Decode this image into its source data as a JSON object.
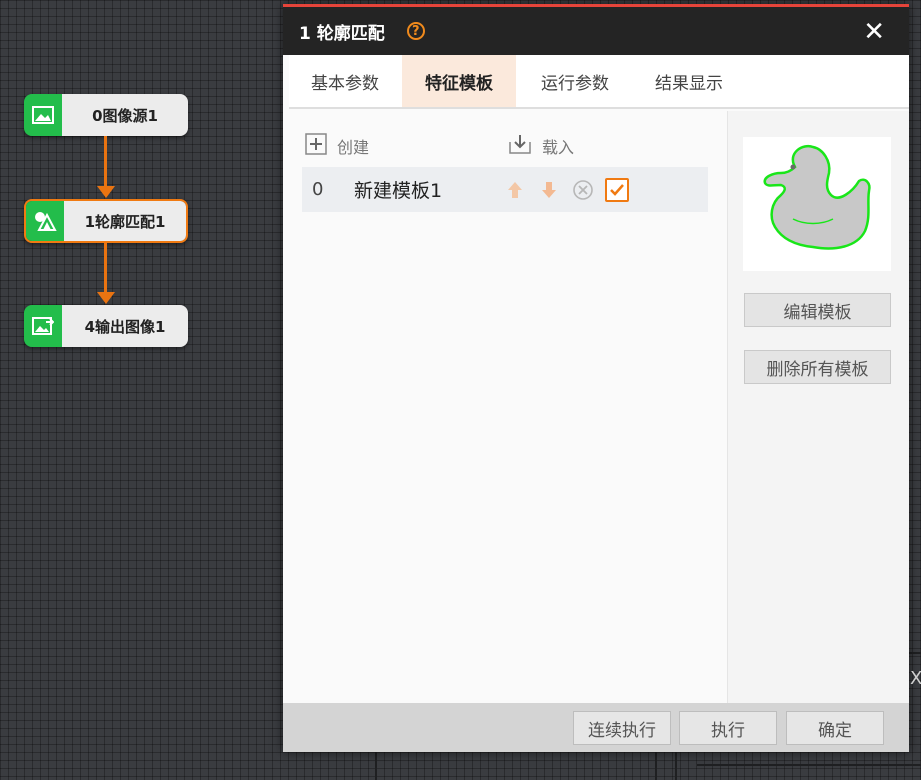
{
  "flow": {
    "nodes": [
      {
        "label": "0图像源1",
        "icon": "image-icon"
      },
      {
        "label": "1轮廓匹配1",
        "icon": "shape-match-icon"
      },
      {
        "label": "4输出图像1",
        "icon": "output-image-icon"
      }
    ]
  },
  "dialog": {
    "title": "1 轮廓匹配",
    "help_icon": "?",
    "close_icon": "✕",
    "tabs": [
      {
        "label": "基本参数",
        "active": false
      },
      {
        "label": "特征模板",
        "active": true
      },
      {
        "label": "运行参数",
        "active": false
      },
      {
        "label": "结果显示",
        "active": false
      }
    ],
    "toolbar": {
      "create_label": "创建",
      "load_label": "载入"
    },
    "templates": [
      {
        "index": "0",
        "name": "新建模板1",
        "checked": true
      }
    ],
    "side_buttons": {
      "edit_label": "编辑模板",
      "delete_all_label": "删除所有模板"
    },
    "footer": {
      "continuous_label": "连续执行",
      "execute_label": "执行",
      "confirm_label": "确定"
    }
  },
  "edge_text": "X",
  "colors": {
    "accent": "#f07a12",
    "node_icon_bg": "#23bd4b",
    "titlebar_bg": "#242424",
    "titlebar_top": "#e5443a",
    "template_outline": "#19e619"
  }
}
